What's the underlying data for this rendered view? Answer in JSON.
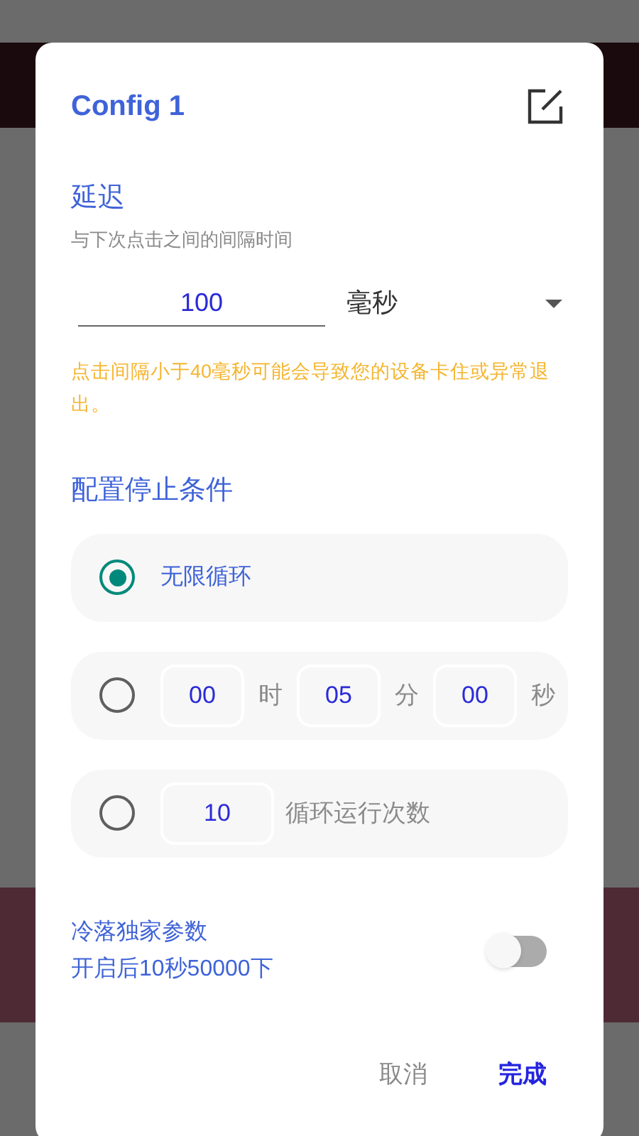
{
  "dialog": {
    "title": "Config 1",
    "delay": {
      "heading": "延迟",
      "description": "与下次点击之间的间隔时间",
      "value": "100",
      "unit": "毫秒",
      "warning": "点击间隔小于40毫秒可能会导致您的设备卡住或异常退出。"
    },
    "stop": {
      "heading": "配置停止条件",
      "options": [
        {
          "kind": "infinite",
          "selected": true,
          "label": "无限循环"
        },
        {
          "kind": "time",
          "selected": false,
          "fields": [
            {
              "value": "00",
              "unit": "时"
            },
            {
              "value": "05",
              "unit": "分"
            },
            {
              "value": "00",
              "unit": "秒"
            }
          ]
        },
        {
          "kind": "count",
          "selected": false,
          "value": "10",
          "label": "循环运行次数"
        }
      ]
    },
    "special": {
      "lines": [
        "冷落独家参数",
        "开启后10秒50000下"
      ],
      "on": false
    },
    "buttons": [
      {
        "kind": "cancel",
        "label": "取消"
      },
      {
        "kind": "confirm",
        "label": "完成"
      }
    ]
  }
}
